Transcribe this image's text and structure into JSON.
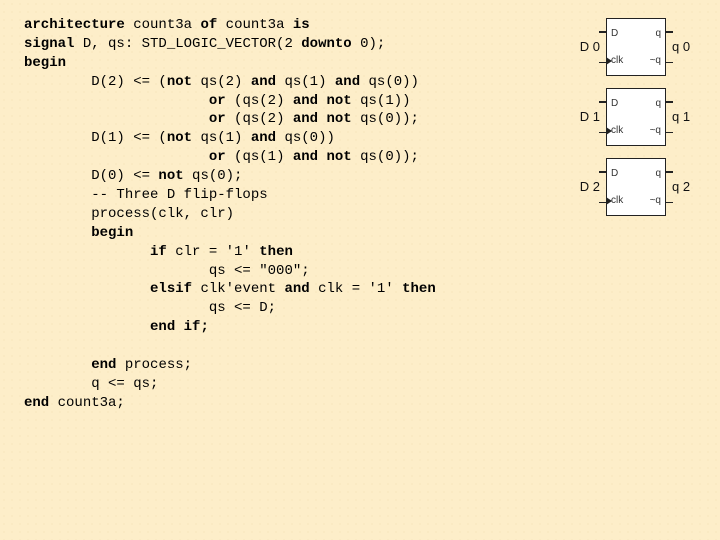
{
  "keywords": {
    "architecture": "architecture",
    "of": "of",
    "is": "is",
    "signal": "signal",
    "downto": "downto",
    "begin": "begin",
    "not": "not",
    "and": "and",
    "or": "or",
    "if": "if",
    "then": "then",
    "elsif": "elsif",
    "end": "end",
    "end_if": "end if;"
  },
  "code": {
    "l1_b": " count3a ",
    "l1_d": " count3a ",
    "l2_b": " D, qs: STD_LOGIC_VECTOR(2 ",
    "l2_d": " 0);",
    "l4": "        D(2) <= (",
    "l4b": " qs(2) ",
    "l4c": " qs(1) ",
    "l4d": " qs(0))",
    "l5a": "                      ",
    "l5b": " (qs(2) ",
    "l5c": " ",
    "l5d": " qs(1))",
    "l6a": "                      ",
    "l6b": " (qs(2) ",
    "l6d": " qs(0));",
    "l7": "        D(1) <= (",
    "l7b": " qs(1) ",
    "l7c": " qs(0))",
    "l8a": "                      ",
    "l8b": " (qs(1) ",
    "l8d": " qs(0));",
    "l9": "        D(0) <= ",
    "l9b": " qs(0);",
    "l10": "        -- Three D flip-flops",
    "l11": "        process(clk, clr)",
    "l12": "        ",
    "l13a": "               ",
    "l13b": " clr = '1' ",
    "l14": "                      qs <= \"000\";",
    "l15a": "               ",
    "l15b": " clk'event ",
    "l15c": " clk = '1' ",
    "l16": "                      qs <= D;",
    "l17": "               ",
    "l19": "        ",
    "l19b": " process;",
    "l20": "        q <= qs;",
    "l21b": " count3a;"
  },
  "ff": {
    "pin_d": "D",
    "pin_q": "q",
    "pin_clk": "clk",
    "pin_nq": "~q",
    "rows": [
      {
        "d": "D 0",
        "q": "q 0"
      },
      {
        "d": "D 1",
        "q": "q 1"
      },
      {
        "d": "D 2",
        "q": "q 2"
      }
    ]
  }
}
